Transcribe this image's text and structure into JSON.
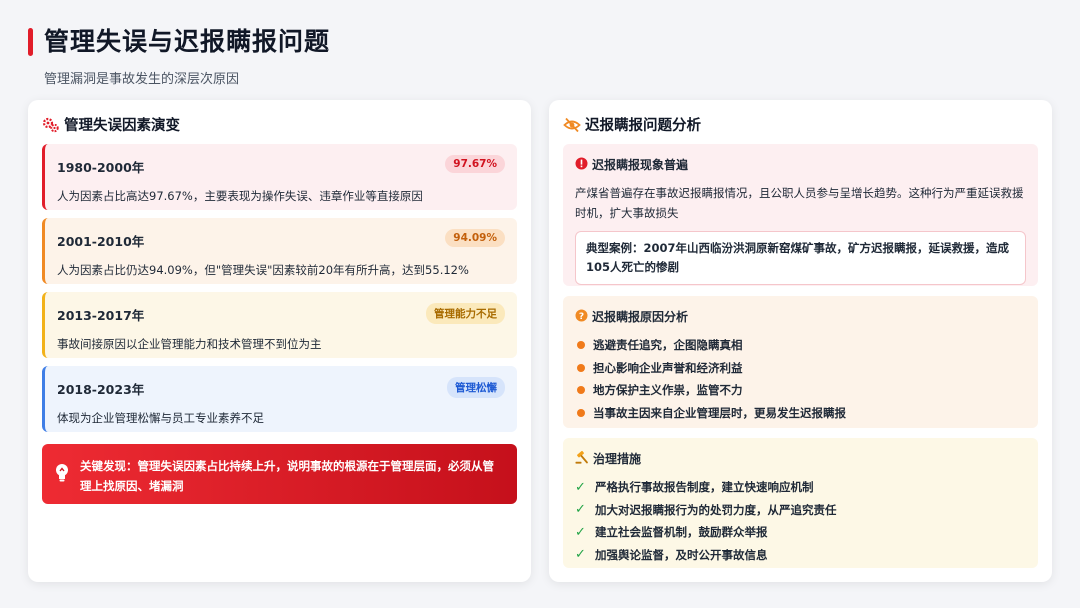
{
  "page": {
    "title": "管理失误与迟报瞒报问题",
    "subtitle": "管理漏洞是事故发生的深层次原因"
  },
  "left_card": {
    "title": "管理失误因素演变",
    "periods": [
      {
        "range": "1980-2000年",
        "badge": "97.67%",
        "desc": "人为因素占比高达97.67%，主要表现为操作失误、违章作业等直接原因"
      },
      {
        "range": "2001-2010年",
        "badge": "94.09%",
        "desc": "人为因素占比仍达94.09%，但\"管理失误\"因素较前20年有所升高，达到55.12%"
      },
      {
        "range": "2013-2017年",
        "badge": "管理能力不足",
        "desc": "事故间接原因以企业管理能力和技术管理不到位为主"
      },
      {
        "range": "2018-2023年",
        "badge": "管理松懈",
        "desc": "体现为企业管理松懈与员工专业素养不足"
      }
    ],
    "key_finding": "关键发现：管理失误因素占比持续上升，说明事故的根源在于管理层面，必须从管理上找原因、堵漏洞"
  },
  "right_card": {
    "title": "迟报瞒报问题分析",
    "phenomenon": {
      "title": "迟报瞒报现象普遍",
      "text": "产煤省普遍存在事故迟报瞒报情况，且公职人员参与呈增长趋势。这种行为严重延误救援时机，扩大事故损失",
      "case": "典型案例：2007年山西临汾洪洞原新窑煤矿事故，矿方迟报瞒报，延误救援，造成105人死亡的惨剧"
    },
    "causes": {
      "title": "迟报瞒报原因分析",
      "items": [
        "逃避责任追究，企图隐瞒真相",
        "担心影响企业声誉和经济利益",
        "地方保护主义作祟，监管不力",
        "当事故主因来自企业管理层时，更易发生迟报瞒报"
      ]
    },
    "measures": {
      "title": "治理措施",
      "items": [
        "严格执行事故报告制度，建立快速响应机制",
        "加大对迟报瞒报行为的处罚力度，从严追究责任",
        "建立社会监督机制，鼓励群众举报",
        "加强舆论监督，及时公开事故信息"
      ]
    }
  },
  "colors": {
    "accent_red": "#e11d2a",
    "orange": "#f08a24",
    "amber": "#f2b21a",
    "blue": "#3f7ee6",
    "green": "#22a447"
  },
  "icons": [
    "gear-icon",
    "eye-slash-icon",
    "alert-icon",
    "question-icon",
    "gavel-icon",
    "lightbulb-icon",
    "check-icon"
  ]
}
